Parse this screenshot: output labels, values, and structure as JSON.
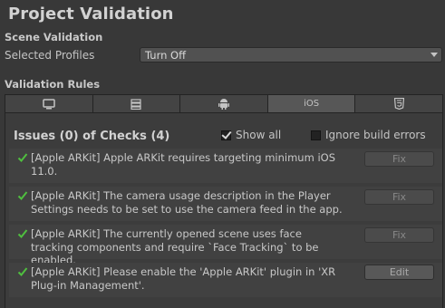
{
  "window": {
    "title": "Project Validation"
  },
  "scene": {
    "heading": "Scene Validation",
    "profiles_label": "Selected Profiles",
    "profiles_value": "Turn Off"
  },
  "rules": {
    "heading": "Validation Rules",
    "tabs": [
      {
        "icon": "desktop-icon",
        "label": "",
        "active": false
      },
      {
        "icon": "server-icon",
        "label": "",
        "active": false
      },
      {
        "icon": "android-icon",
        "label": "",
        "active": false
      },
      {
        "icon": "",
        "label": "iOS",
        "active": true
      },
      {
        "icon": "html5-icon",
        "label": "",
        "active": false
      }
    ]
  },
  "issues": {
    "header": "Issues (0) of Checks (4)",
    "show_all_label": "Show all",
    "show_all_checked": true,
    "ignore_label": "Ignore build errors",
    "ignore_checked": false,
    "items": [
      {
        "status": "passed",
        "text": "[Apple ARKit] Apple ARKit requires targeting minimum iOS 11.0.",
        "button": "Fix"
      },
      {
        "status": "passed",
        "text": "[Apple ARKit] The camera usage description in the Player Settings needs to be set to use the camera feed in the app.",
        "button": "Fix"
      },
      {
        "status": "passed",
        "text": "[Apple ARKit] The currently opened scene uses face tracking components and require `Face Tracking` to be enabled.",
        "button": "Fix"
      },
      {
        "status": "passed",
        "text": "[Apple ARKit] Please enable the 'Apple ARKit' plugin in 'XR Plug-in Management'.",
        "button": "Edit"
      }
    ]
  },
  "colors": {
    "check_green": "#4fbf3f",
    "background": "#383838"
  }
}
